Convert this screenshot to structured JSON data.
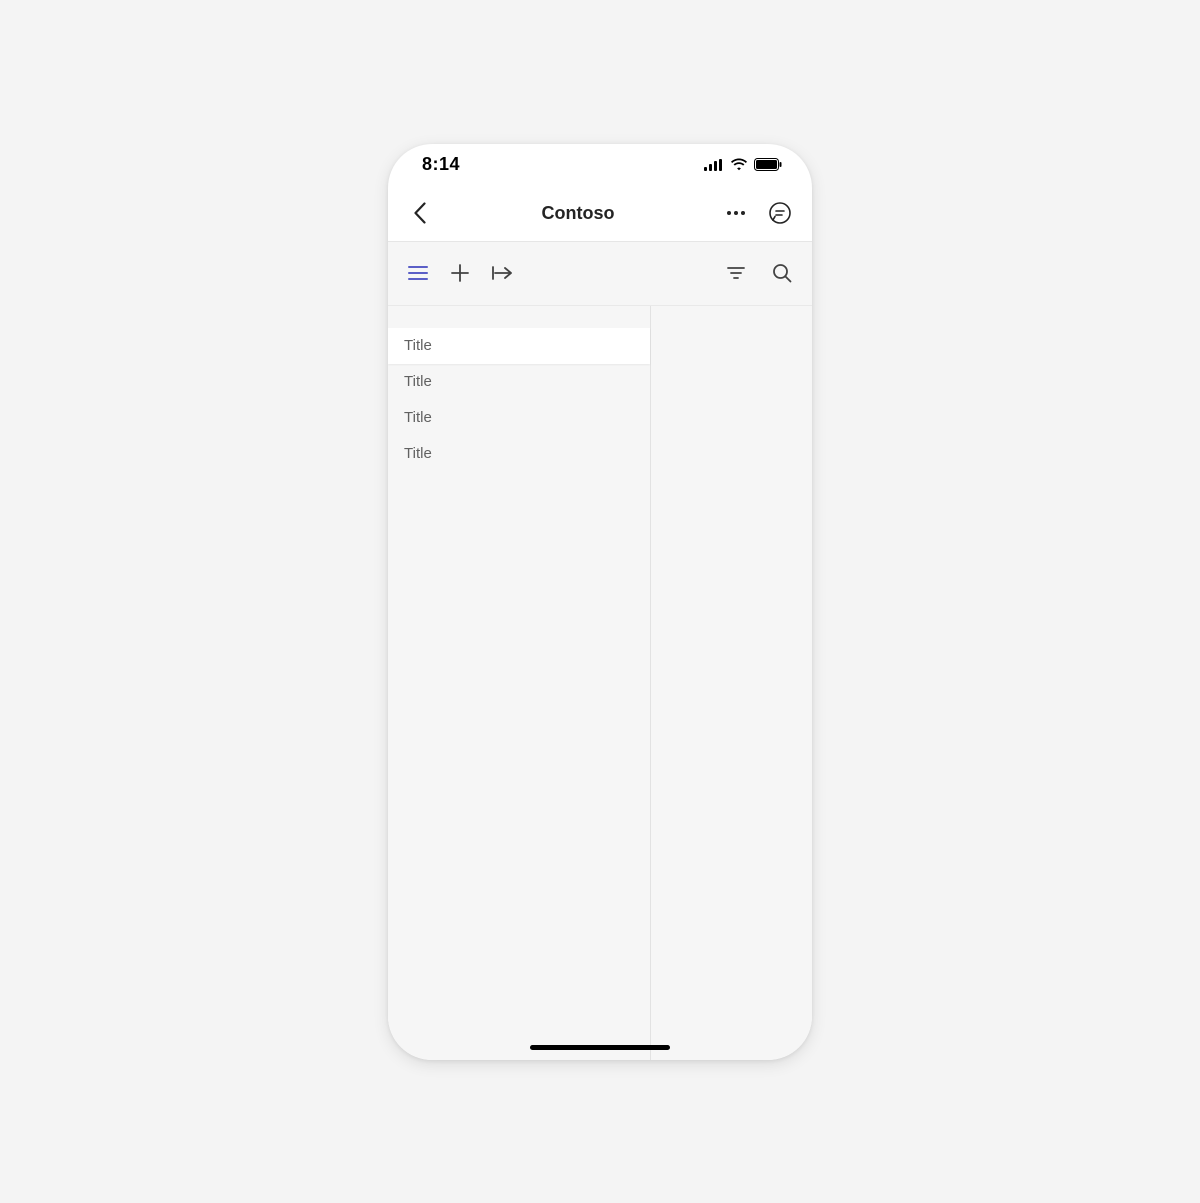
{
  "status": {
    "time": "8:14"
  },
  "header": {
    "title": "Contoso"
  },
  "list": {
    "items": [
      {
        "label": "Title",
        "selected": true
      },
      {
        "label": "Title",
        "selected": false
      },
      {
        "label": "Title",
        "selected": false
      },
      {
        "label": "Title",
        "selected": false
      }
    ]
  }
}
